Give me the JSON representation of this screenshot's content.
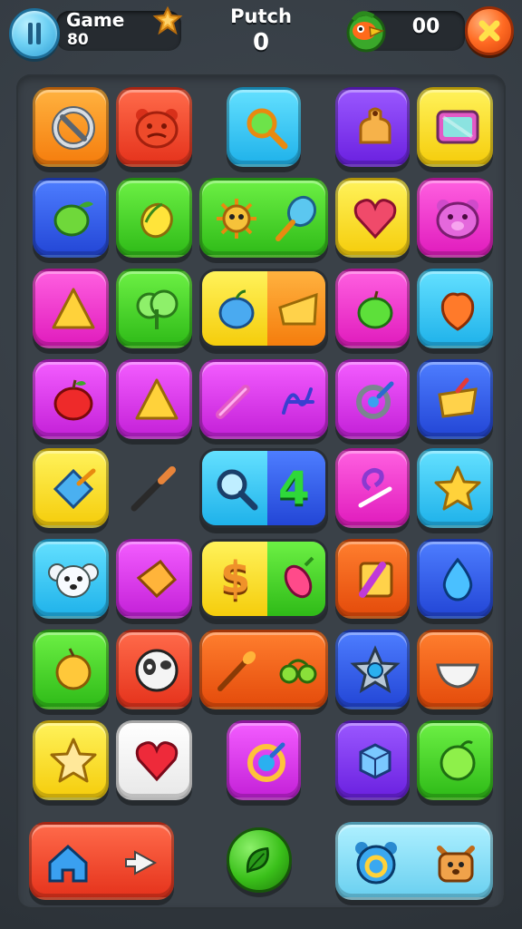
{
  "header": {
    "game_label": "Game",
    "game_score": "80",
    "title_label": "Putch",
    "title_value": "0",
    "coins": "00"
  },
  "board": {
    "special_tile_number": "4",
    "special_tile_dollar": "$"
  },
  "colors": {
    "background": "#343b42",
    "board": "#3a4148",
    "pause_button": "#4fc3ef",
    "close_button": "#ff6a22"
  },
  "icons": [
    "pause-icon",
    "gem-icon",
    "parrot-coin-icon",
    "close-icon",
    "target-icon",
    "bear-icon",
    "magnifier-icon",
    "bell-icon",
    "tv-icon",
    "lime-icon",
    "lemon-icon",
    "virus-icon",
    "ice-cream-icon",
    "heart-icon",
    "pig-icon",
    "triangle-icon",
    "tree-icon",
    "apple-icon",
    "cheese-icon",
    "green-apple-icon",
    "peach-icon",
    "apple-icon",
    "triangle-icon",
    "pencil-icon",
    "scribble-icon",
    "compass-icon",
    "drum-icon",
    "kite-icon",
    "brush-icon",
    "magnifier-icon",
    "swirl-icon",
    "star-icon",
    "koala-icon",
    "cheese-icon",
    "dollar-icon",
    "carrot-icon",
    "crayon-icon",
    "drop-icon",
    "lemon-icon",
    "panda-icon",
    "torch-icon",
    "olive-icon",
    "gear-star-icon",
    "bowl-icon",
    "star-icon",
    "heart-icon",
    "ring-icon",
    "cube-icon",
    "melon-icon",
    "home-icon",
    "play-icon",
    "leaf-icon",
    "bear-ring-icon",
    "bear-face-icon"
  ]
}
